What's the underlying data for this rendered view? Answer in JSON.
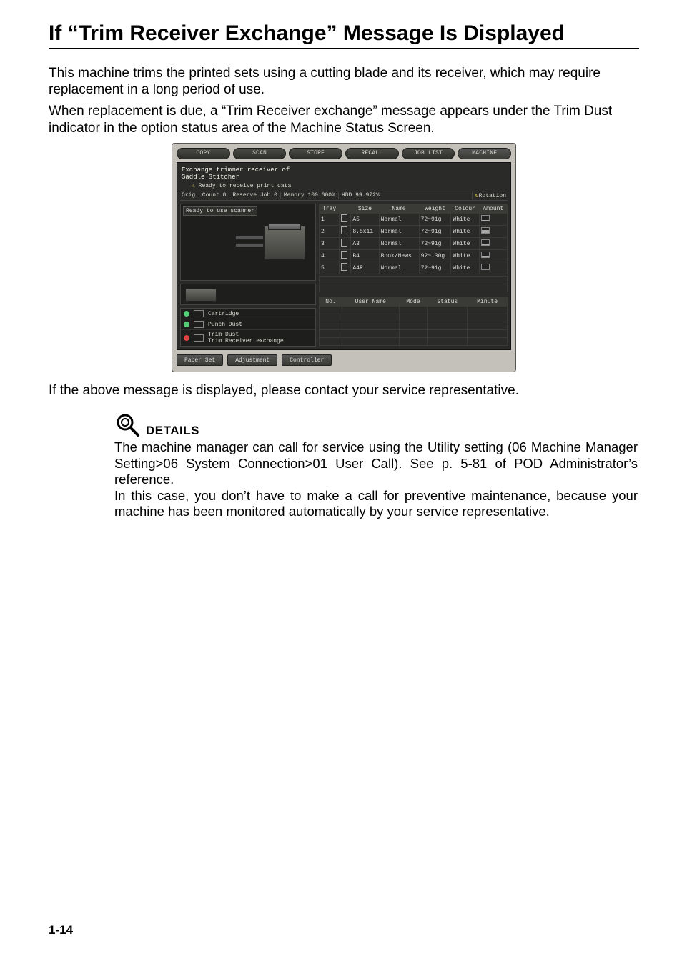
{
  "title": "If “Trim Receiver Exchange” Message Is Displayed",
  "para1": "This machine trims the printed sets using a cutting blade and its receiver, which may require replacement in a long period of use.",
  "para2": "When replacement is due, a “Trim Receiver exchange” message appears under the Trim Dust indicator in the option status area of the Machine Status Screen.",
  "after_screenshot": "If the above message is displayed, please contact your service representative.",
  "details": {
    "label": "DETAILS",
    "p1": "The machine manager can call for service using the Utility setting (06 Machine Manager Setting>06 System Connection>01 User Call). See p. 5-81 of POD Administrator’s reference.",
    "p2": "In this case, you don’t have to make a call for preventive maintenance, because your machine has been monitored automatically by your service representative."
  },
  "page_number": "1-14",
  "screenshot": {
    "tabs": [
      "COPY",
      "SCAN",
      "STORE",
      "RECALL",
      "JOB LIST",
      "MACHINE"
    ],
    "message_line1": "Exchange trimmer receiver of",
    "message_line2": "Saddle Stitcher",
    "sub_message": "Ready to receive print data",
    "status_bar": {
      "orig_count_label": "Orig. Count",
      "orig_count": "0",
      "reserve_label": "Reserve Job",
      "reserve": "0",
      "memory_label": "Memory",
      "memory": "100.000%",
      "hdd_label": "HDD",
      "hdd": "99.972%",
      "rotation_label": "Rotation"
    },
    "scanner_label": "Ready to use scanner",
    "tray_headers": [
      "Tray",
      "",
      "Size",
      "Name",
      "Weight",
      "Colour",
      "Amount"
    ],
    "trays": [
      {
        "n": "1",
        "size": "A5",
        "name": "Normal",
        "weight": "72~91g",
        "colour": "White",
        "amount": 20
      },
      {
        "n": "2",
        "size": "8.5x11",
        "name": "Normal",
        "weight": "72~91g",
        "colour": "White",
        "amount": 60
      },
      {
        "n": "3",
        "size": "A3",
        "name": "Normal",
        "weight": "72~91g",
        "colour": "White",
        "amount": 30
      },
      {
        "n": "4",
        "size": "B4",
        "name": "Book/News",
        "weight": "92~130g",
        "colour": "White",
        "amount": 30
      },
      {
        "n": "5",
        "size": "A4R",
        "name": "Normal",
        "weight": "72~91g",
        "colour": "White",
        "amount": 25
      }
    ],
    "job_headers": [
      "No.",
      "User Name",
      "Mode",
      "Status",
      "Minute"
    ],
    "supplies": [
      {
        "status": "green",
        "label": "Cartridge"
      },
      {
        "status": "green",
        "label": "Punch Dust"
      },
      {
        "status": "red",
        "label": "Trim Dust",
        "sub": "Trim Receiver exchange"
      }
    ],
    "buttons": [
      "Paper Set",
      "Adjustment",
      "Controller"
    ]
  }
}
